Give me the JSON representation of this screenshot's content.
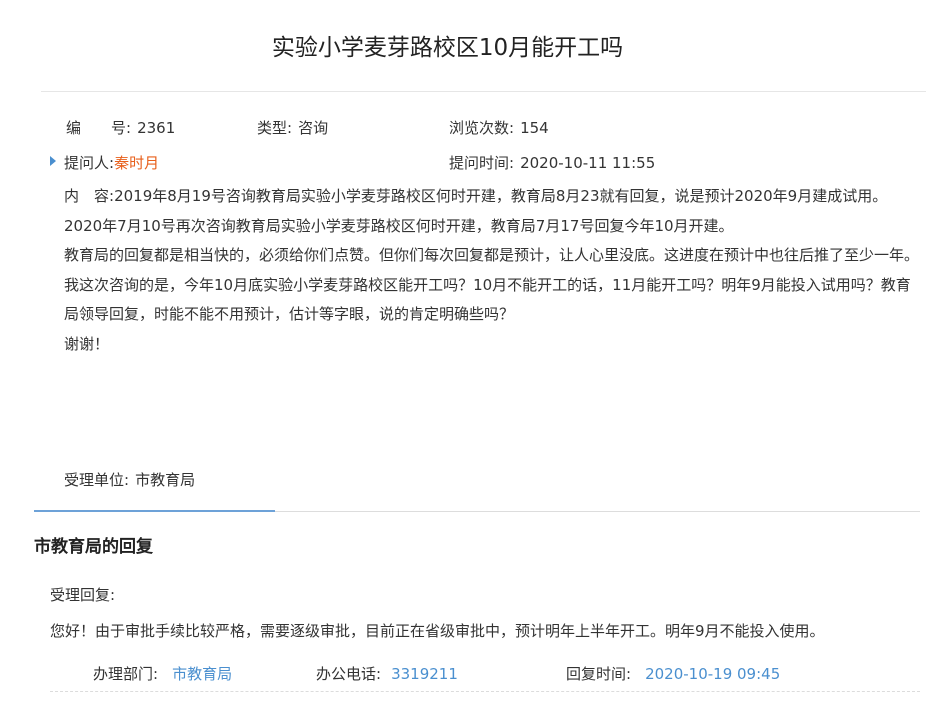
{
  "title": "实验小学麦芽路校区10月能开工吗",
  "meta": {
    "number_label": "编　　号:",
    "number_value": "2361",
    "type_label": "类型:",
    "type_value": "咨询",
    "views_label": "浏览次数:",
    "views_value": "154",
    "asker_label": "提问人:",
    "asker_value": "秦时月",
    "ask_time_label": "提问时间:",
    "ask_time_value": "2020-10-11 11:55"
  },
  "content": {
    "label": "内　容:",
    "paragraphs": [
      "2019年8月19号咨询教育局实验小学麦芽路校区何时开建，教育局8月23就有回复，说是预计2020年9月建成试用。",
      "2020年7月10号再次咨询教育局实验小学麦芽路校区何时开建，教育局7月17号回复今年10月开建。",
      "教育局的回复都是相当快的，必须给你们点赞。但你们每次回复都是预计，让人心里没底。这进度在预计中也往后推了至少一年。",
      "我这次咨询的是，今年10月底实验小学麦芽路校区能开工吗？10月不能开工的话，11月能开工吗？明年9月能投入试用吗？教育局领导回复，时能不能不用预计，估计等字眼，说的肯定明确些吗？",
      "谢谢！"
    ]
  },
  "handling_unit_label": "受理单位:",
  "handling_unit_value": "市教育局",
  "reply": {
    "section_title": "市教育局的回复",
    "accept_label": "受理回复:",
    "text": "您好！由于审批手续比较严格，需要逐级审批，目前正在省级审批中，预计明年上半年开工。明年9月不能投入使用。",
    "dept_label": "办理部门:",
    "dept_value": "市教育局",
    "phone_label": "办公电话:",
    "phone_value": "3319211",
    "time_label": "回复时间:",
    "time_value": "2020-10-19 09:45"
  },
  "colors": {
    "accent_blue": "#4a8fcf",
    "asker_orange": "#e8601c",
    "tab_accent": "#6da2d8"
  }
}
